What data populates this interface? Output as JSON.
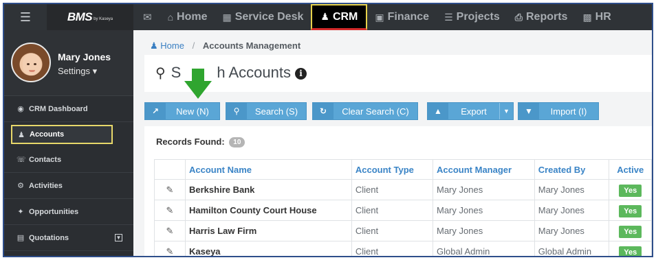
{
  "app": {
    "logo": "BMS",
    "logo_by": "by Kaseya"
  },
  "topnav": {
    "mail_icon": "envelope-icon",
    "items": [
      {
        "label": "Home",
        "icon": "home-icon"
      },
      {
        "label": "Service Desk",
        "icon": "sitemap-icon"
      },
      {
        "label": "CRM",
        "icon": "users-icon"
      },
      {
        "label": "Finance",
        "icon": "money-icon"
      },
      {
        "label": "Projects",
        "icon": "list-icon"
      },
      {
        "label": "Reports",
        "icon": "print-icon"
      },
      {
        "label": "HR",
        "icon": "briefcase-icon"
      }
    ],
    "active": "CRM"
  },
  "profile": {
    "name": "Mary Jones",
    "settings": "Settings ▾"
  },
  "sidebar": {
    "items": [
      {
        "label": "CRM Dashboard",
        "icon": "dashboard-icon"
      },
      {
        "label": "Accounts",
        "icon": "users-icon"
      },
      {
        "label": "Contacts",
        "icon": "address-card-icon"
      },
      {
        "label": "Activities",
        "icon": "cogs-icon"
      },
      {
        "label": "Opportunities",
        "icon": "magic-wand-icon"
      },
      {
        "label": "Quotations",
        "icon": "file-icon"
      }
    ],
    "active": "Accounts"
  },
  "breadcrumb": {
    "home": "Home",
    "sep": "/",
    "current": "Accounts Management"
  },
  "page": {
    "title_left": "S",
    "title_right": "h Accounts",
    "info": "i"
  },
  "toolbar": {
    "new": "New (N)",
    "search": "Search (S)",
    "clear": "Clear Search (C)",
    "export": "Export",
    "import": "Import (I)"
  },
  "records": {
    "label": "Records Found:",
    "count": "10"
  },
  "table": {
    "columns": [
      "Account Name",
      "Account Type",
      "Account Manager",
      "Created By",
      "Active"
    ],
    "rows": [
      {
        "name": "Berkshire Bank",
        "type": "Client",
        "manager": "Mary Jones",
        "created_by": "Mary Jones",
        "active": "Yes"
      },
      {
        "name": "Hamilton County Court House",
        "type": "Client",
        "manager": "Mary Jones",
        "created_by": "Mary Jones",
        "active": "Yes"
      },
      {
        "name": "Harris Law Firm",
        "type": "Client",
        "manager": "Mary Jones",
        "created_by": "Mary Jones",
        "active": "Yes"
      },
      {
        "name": "Kaseya",
        "type": "Client",
        "manager": "Global Admin",
        "created_by": "Global Admin",
        "active": "Yes"
      }
    ]
  },
  "colors": {
    "topbar": "#2f3337",
    "sidebar": "#2b2e32",
    "accent_blue": "#5aa6d6",
    "active_green": "#5cb85c",
    "highlight_yellow": "#e8d86a",
    "arrow_green": "#2fa52f"
  }
}
